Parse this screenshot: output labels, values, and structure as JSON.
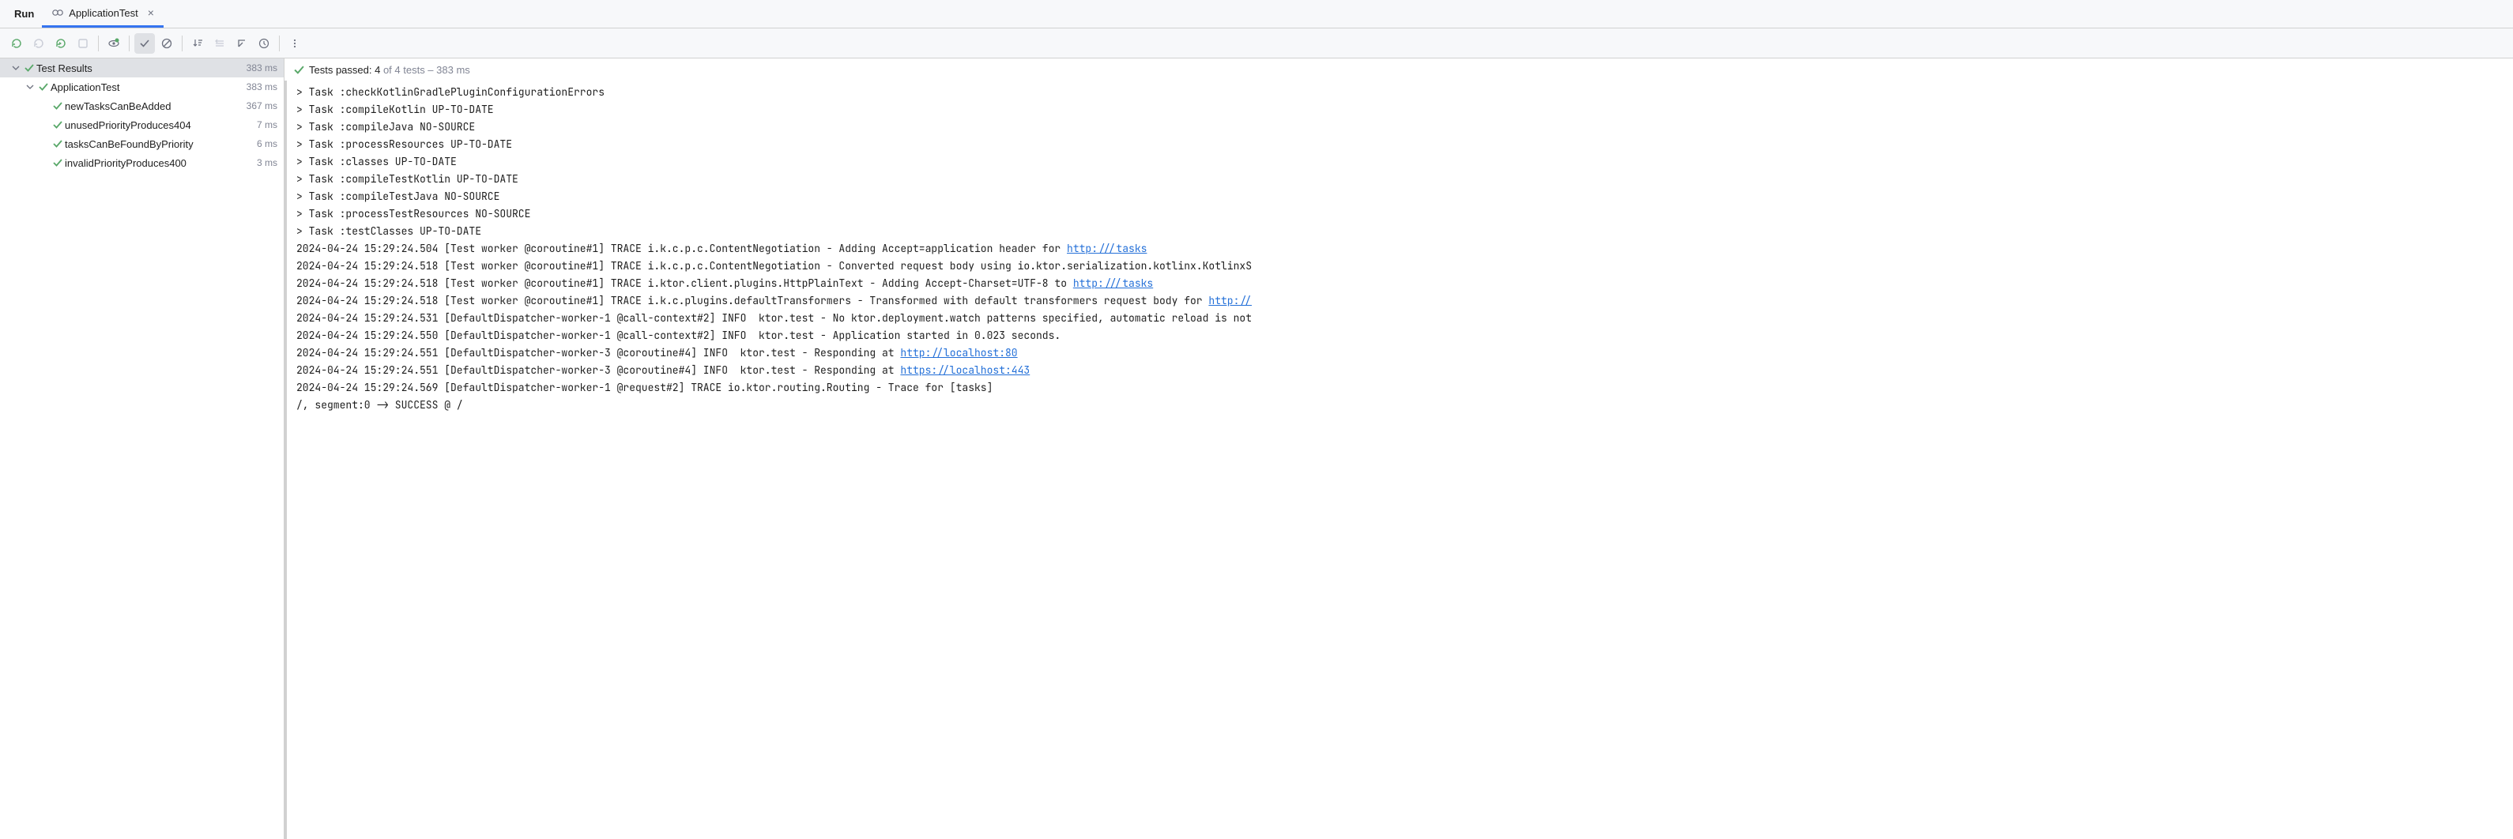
{
  "tabbar": {
    "title": "Run",
    "tab_label": "ApplicationTest"
  },
  "summary": {
    "prefix": "Tests passed: 4",
    "suffix": " of 4 tests – 383 ms"
  },
  "tree": {
    "root": {
      "label": "Test Results",
      "time": "383 ms"
    },
    "suite": {
      "label": "ApplicationTest",
      "time": "383 ms"
    },
    "tests": [
      {
        "label": "newTasksCanBeAdded",
        "time": "367 ms"
      },
      {
        "label": "unusedPriorityProduces404",
        "time": "7 ms"
      },
      {
        "label": "tasksCanBeFoundByPriority",
        "time": "6 ms"
      },
      {
        "label": "invalidPriorityProduces400",
        "time": "3 ms"
      }
    ]
  },
  "console": {
    "lines": [
      {
        "text": "> Task :checkKotlinGradlePluginConfigurationErrors"
      },
      {
        "text": "> Task :compileKotlin UP-TO-DATE"
      },
      {
        "text": "> Task :compileJava NO-SOURCE"
      },
      {
        "text": "> Task :processResources UP-TO-DATE"
      },
      {
        "text": "> Task :classes UP-TO-DATE"
      },
      {
        "text": "> Task :compileTestKotlin UP-TO-DATE"
      },
      {
        "text": "> Task :compileTestJava NO-SOURCE"
      },
      {
        "text": "> Task :processTestResources NO-SOURCE"
      },
      {
        "text": "> Task :testClasses UP-TO-DATE"
      },
      {
        "text": "2024-04-24 15:29:24.504 [Test worker @coroutine#1] TRACE i.k.c.p.c.ContentNegotiation - Adding Accept=application header for ",
        "link": "http:///tasks"
      },
      {
        "text": "2024-04-24 15:29:24.518 [Test worker @coroutine#1] TRACE i.k.c.p.c.ContentNegotiation - Converted request body using io.ktor.serialization.kotlinx.KotlinxS"
      },
      {
        "text": "2024-04-24 15:29:24.518 [Test worker @coroutine#1] TRACE i.ktor.client.plugins.HttpPlainText - Adding Accept-Charset=UTF-8 to ",
        "link": "http:///tasks"
      },
      {
        "text": "2024-04-24 15:29:24.518 [Test worker @coroutine#1] TRACE i.k.c.plugins.defaultTransformers - Transformed with default transformers request body for ",
        "link": "http://"
      },
      {
        "text": "2024-04-24 15:29:24.531 [DefaultDispatcher-worker-1 @call-context#2] INFO  ktor.test - No ktor.deployment.watch patterns specified, automatic reload is not"
      },
      {
        "text": "2024-04-24 15:29:24.550 [DefaultDispatcher-worker-1 @call-context#2] INFO  ktor.test - Application started in 0.023 seconds."
      },
      {
        "text": "2024-04-24 15:29:24.551 [DefaultDispatcher-worker-3 @coroutine#4] INFO  ktor.test - Responding at ",
        "link": "http://localhost:80"
      },
      {
        "text": "2024-04-24 15:29:24.551 [DefaultDispatcher-worker-3 @coroutine#4] INFO  ktor.test - Responding at ",
        "link": "https://localhost:443"
      },
      {
        "text": "2024-04-24 15:29:24.569 [DefaultDispatcher-worker-1 @request#2] TRACE io.ktor.routing.Routing - Trace for [tasks]"
      },
      {
        "text": "/, segment:0 -> SUCCESS @ /"
      }
    ]
  }
}
